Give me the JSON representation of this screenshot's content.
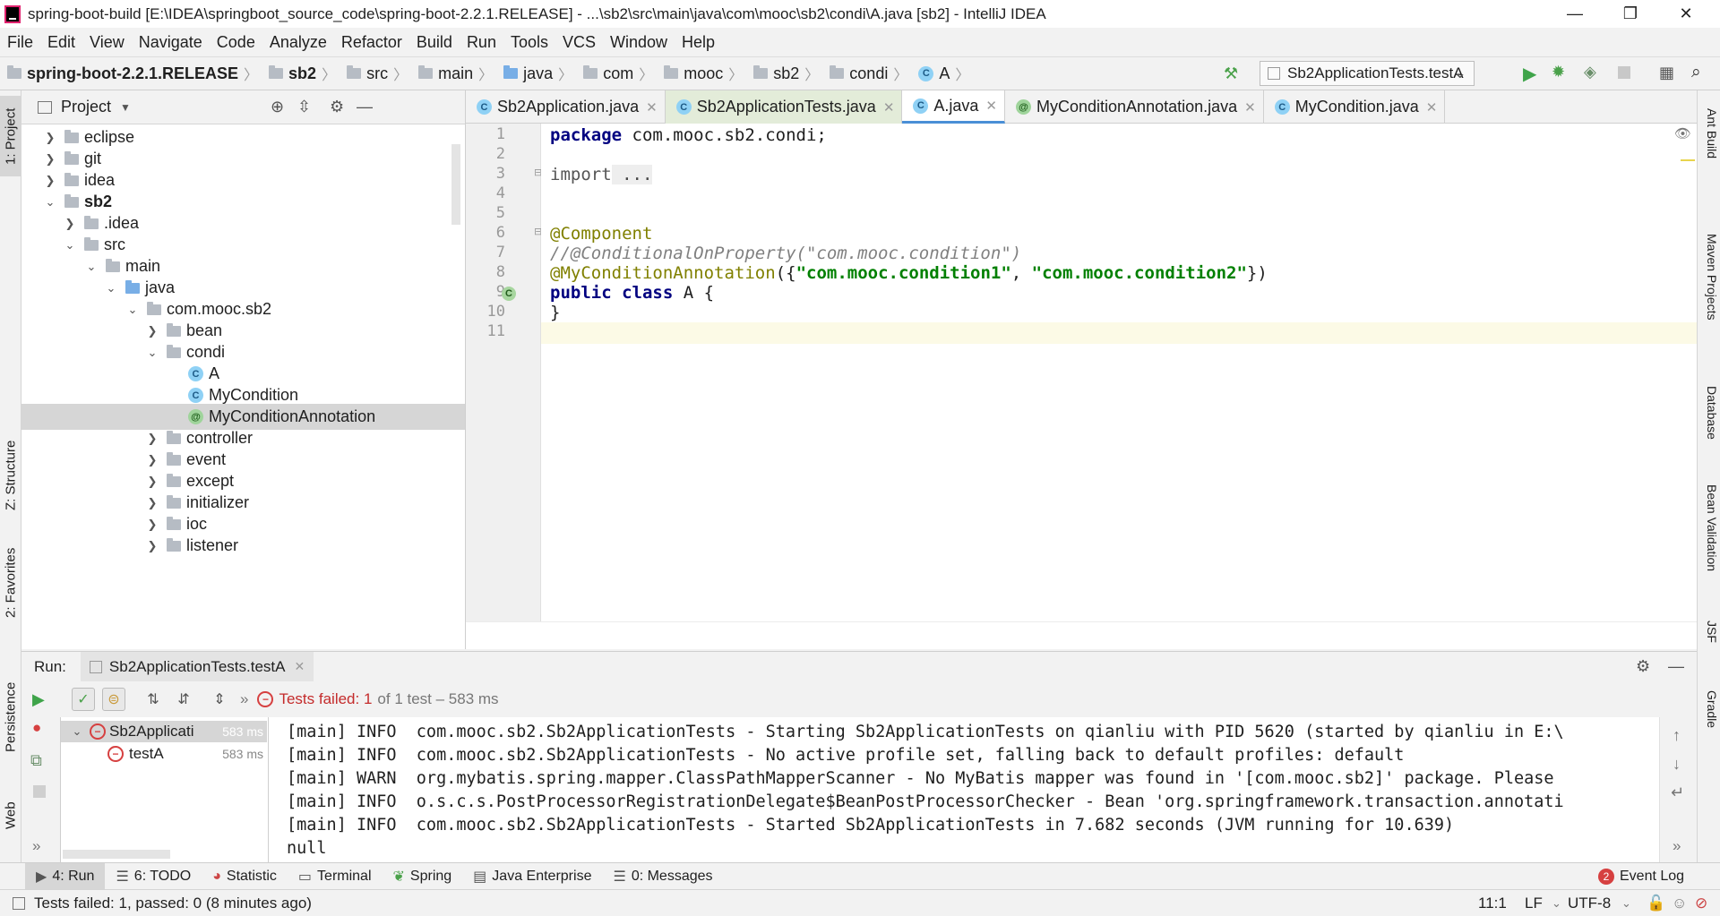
{
  "window": {
    "title": "spring-boot-build [E:\\IDEA\\springboot_source_code\\spring-boot-2.2.1.RELEASE] - ...\\sb2\\src\\main\\java\\com\\mooc\\sb2\\condi\\A.java [sb2] - IntelliJ IDEA",
    "minimize": "—",
    "restore": "❐",
    "close": "✕"
  },
  "menu": [
    "File",
    "Edit",
    "View",
    "Navigate",
    "Code",
    "Analyze",
    "Refactor",
    "Build",
    "Run",
    "Tools",
    "VCS",
    "Window",
    "Help"
  ],
  "breadcrumb": [
    "spring-boot-2.2.1.RELEASE",
    "sb2",
    "src",
    "main",
    "java",
    "com",
    "mooc",
    "sb2",
    "condi",
    "A"
  ],
  "run_config": "Sb2ApplicationTests.testA",
  "left_strip": {
    "project": "1: Project",
    "structure": "Z: Structure",
    "favorites": "2: Favorites",
    "persistence": "Persistence",
    "web": "Web"
  },
  "right_strip": {
    "ant": "Ant Build",
    "maven": "Maven Projects",
    "database": "Database",
    "bean": "Bean Validation",
    "jsf": "JSF",
    "gradle": "Gradle"
  },
  "project_panel": {
    "title": "Project",
    "items": [
      "eclipse",
      "git",
      "idea",
      "sb2",
      ".idea",
      "src",
      "main",
      "java",
      "com.mooc.sb2",
      "bean",
      "condi",
      "A",
      "MyCondition",
      "MyConditionAnnotation",
      "controller",
      "event",
      "except",
      "initializer",
      "ioc",
      "listener"
    ]
  },
  "editor": {
    "tabs": [
      "Sb2Application.java",
      "Sb2ApplicationTests.java",
      "A.java",
      "MyConditionAnnotation.java",
      "MyCondition.java"
    ],
    "line_numbers": [
      "1",
      "2",
      "3",
      "4",
      "5",
      "6",
      "7",
      "8",
      "9",
      "10",
      "11"
    ],
    "code": {
      "l1_kw": "package",
      "l1_rest": " com.mooc.sb2.condi;",
      "l3_kw": "import",
      "l3_rest": " ...",
      "l6": "@Component",
      "l7": "//@ConditionalOnProperty(\"com.mooc.condition\")",
      "l8_ann": "@MyConditionAnnotation",
      "l8_open": "({",
      "l8_s1": "\"com.mooc.condition1\"",
      "l8_comma": ", ",
      "l8_s2": "\"com.mooc.condition2\"",
      "l8_close": "})",
      "l9_kw": "public class",
      "l9_rest": " A {",
      "l10": "}"
    }
  },
  "run": {
    "label": "Run:",
    "tab": "Sb2ApplicationTests.testA",
    "status_failed": "Tests failed: 1",
    "status_rest": "of 1 test – 583 ms",
    "tree": [
      {
        "name": "Sb2Applicati",
        "time": "583 ms"
      },
      {
        "name": "testA",
        "time": "583 ms"
      }
    ],
    "console": [
      "[main] INFO  com.mooc.sb2.Sb2ApplicationTests - Starting Sb2ApplicationTests on qianliu with PID 5620 (started by qianliu in E:\\",
      "[main] INFO  com.mooc.sb2.Sb2ApplicationTests - No active profile set, falling back to default profiles: default",
      "[main] WARN  org.mybatis.spring.mapper.ClassPathMapperScanner - No MyBatis mapper was found in '[com.mooc.sb2]' package. Please",
      "[main] INFO  o.s.c.s.PostProcessorRegistrationDelegate$BeanPostProcessorChecker - Bean 'org.springframework.transaction.annotati",
      "[main] INFO  com.mooc.sb2.Sb2ApplicationTests - Started Sb2ApplicationTests in 7.682 seconds (JVM running for 10.639)",
      "null"
    ]
  },
  "bottom_tabs": [
    "4: Run",
    "6: TODO",
    "Statistic",
    "Terminal",
    "Spring",
    "Java Enterprise",
    "0: Messages"
  ],
  "event_log": {
    "count": "2",
    "label": "Event Log"
  },
  "status": {
    "message": "Tests failed: 1, passed: 0 (8 minutes ago)",
    "position": "11:1",
    "line_sep": "LF",
    "encoding": "UTF-8"
  }
}
